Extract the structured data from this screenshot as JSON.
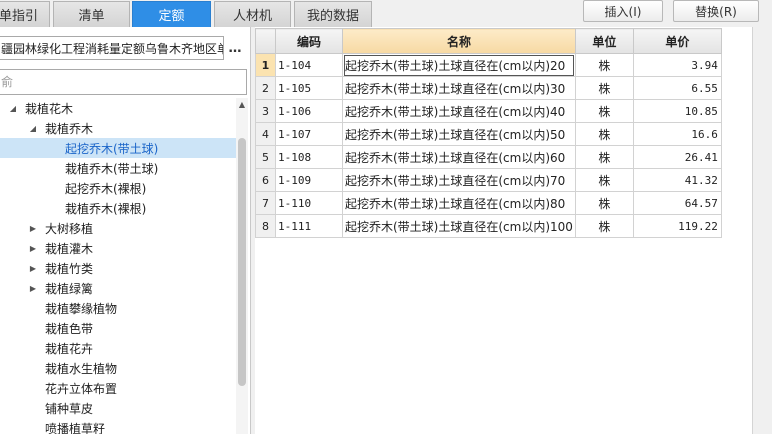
{
  "tabs": [
    {
      "label": "单指引"
    },
    {
      "label": "清单"
    },
    {
      "label": "定额"
    },
    {
      "label": "人材机"
    },
    {
      "label": "我的数据"
    }
  ],
  "toolbar": {
    "insert_label": "插入(I)",
    "replace_label": "替换(R)"
  },
  "library": {
    "selected": "疆园林绿化工程消耗量定额乌鲁木齐地区单",
    "more_label": "…"
  },
  "search": {
    "placeholder": "俞"
  },
  "tree": {
    "items": [
      {
        "label": "栽植花木"
      },
      {
        "label": "栽植乔木"
      },
      {
        "label": "起挖乔木(带土球)"
      },
      {
        "label": "栽植乔木(带土球)"
      },
      {
        "label": "起挖乔木(裸根)"
      },
      {
        "label": "栽植乔木(裸根)"
      },
      {
        "label": "大树移植"
      },
      {
        "label": "栽植灌木"
      },
      {
        "label": "栽植竹类"
      },
      {
        "label": "栽植绿篱"
      },
      {
        "label": "栽植攀缘植物"
      },
      {
        "label": "栽植色带"
      },
      {
        "label": "栽植花卉"
      },
      {
        "label": "栽植水生植物"
      },
      {
        "label": "花卉立体布置"
      },
      {
        "label": "铺种草皮"
      },
      {
        "label": "喷播植草籽"
      }
    ]
  },
  "grid": {
    "headers": {
      "code": "编码",
      "name": "名称",
      "unit": "单位",
      "price": "单价"
    },
    "rows": [
      {
        "idx": "1",
        "code": "1-104",
        "name": "起挖乔木(带土球)土球直径在(cm以内)20",
        "unit": "株",
        "price": "3.94"
      },
      {
        "idx": "2",
        "code": "1-105",
        "name": "起挖乔木(带土球)土球直径在(cm以内)30",
        "unit": "株",
        "price": "6.55"
      },
      {
        "idx": "3",
        "code": "1-106",
        "name": "起挖乔木(带土球)土球直径在(cm以内)40",
        "unit": "株",
        "price": "10.85"
      },
      {
        "idx": "4",
        "code": "1-107",
        "name": "起挖乔木(带土球)土球直径在(cm以内)50",
        "unit": "株",
        "price": "16.6"
      },
      {
        "idx": "5",
        "code": "1-108",
        "name": "起挖乔木(带土球)土球直径在(cm以内)60",
        "unit": "株",
        "price": "26.41"
      },
      {
        "idx": "6",
        "code": "1-109",
        "name": "起挖乔木(带土球)土球直径在(cm以内)70",
        "unit": "株",
        "price": "41.32"
      },
      {
        "idx": "7",
        "code": "1-110",
        "name": "起挖乔木(带土球)土球直径在(cm以内)80",
        "unit": "株",
        "price": "64.57"
      },
      {
        "idx": "8",
        "code": "1-111",
        "name": "起挖乔木(带土球)土球直径在(cm以内)100",
        "unit": "株",
        "price": "119.22"
      }
    ]
  },
  "colors": {
    "accent": "#2f8ee6",
    "header_highlight": "#f7d9a3",
    "tree_selected": "#cce4f7"
  },
  "icons": {
    "expanded": "triangle-down-icon",
    "collapsed": "triangle-right-icon",
    "more": "ellipsis-icon"
  }
}
